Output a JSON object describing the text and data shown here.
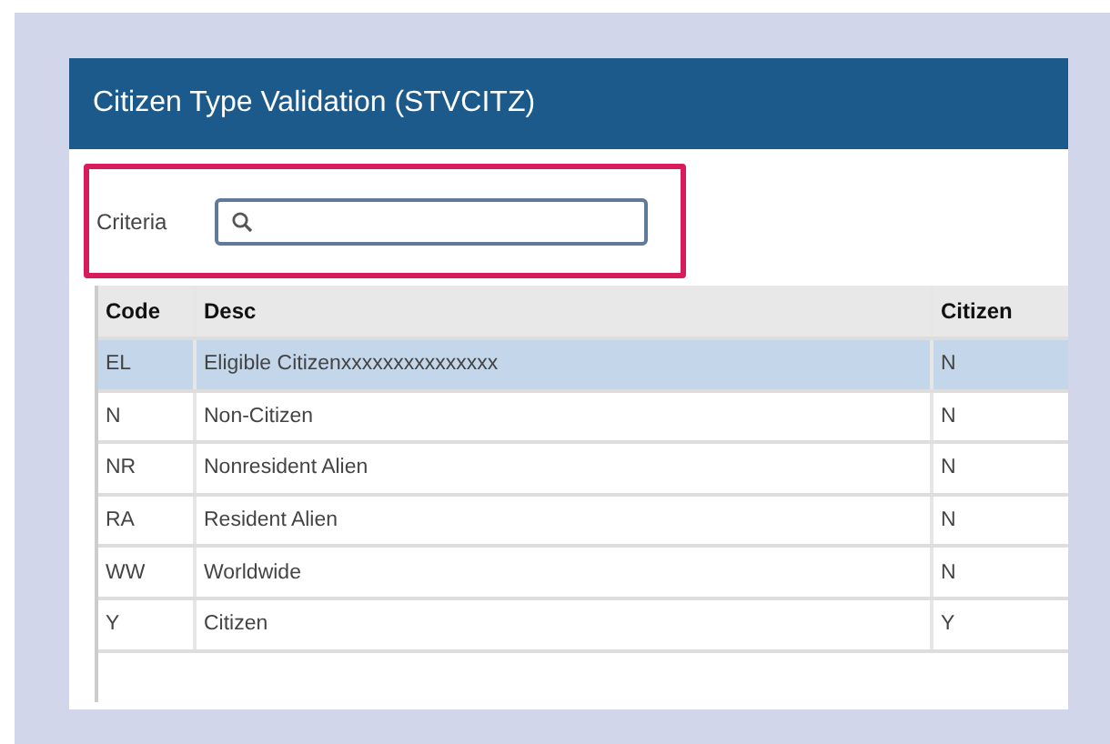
{
  "window": {
    "title": "Citizen Type Validation (STVCITZ)"
  },
  "criteria": {
    "label": "Criteria",
    "highlighted": true
  },
  "table": {
    "columns": [
      "Code",
      "Desc",
      "Citizen"
    ],
    "rows": [
      {
        "cells": [
          "EL",
          "Eligible Citizenxxxxxxxxxxxxxxx",
          "N"
        ],
        "selected": true
      },
      {
        "cells": [
          "N",
          "Non-Citizen",
          "N"
        ],
        "selected": false
      },
      {
        "cells": [
          "NR",
          "Nonresident Alien",
          "N"
        ],
        "selected": false
      },
      {
        "cells": [
          "RA",
          "Resident Alien",
          "N"
        ],
        "selected": false
      },
      {
        "cells": [
          "WW",
          "Worldwide",
          "N"
        ],
        "selected": false
      },
      {
        "cells": [
          "Y",
          "Citizen",
          "Y"
        ],
        "selected": false
      }
    ]
  }
}
